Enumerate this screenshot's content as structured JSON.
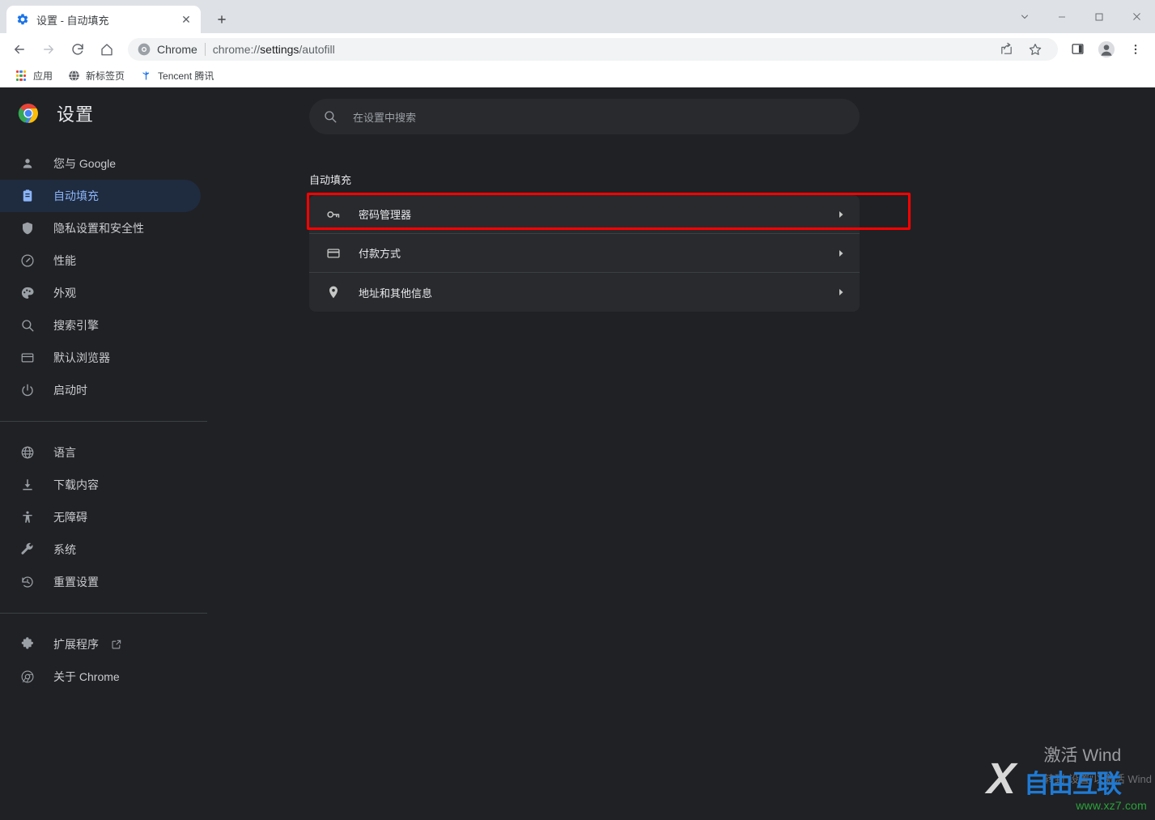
{
  "window": {
    "controls": [
      {
        "name": "tab-search-button",
        "glyph": "chevron-down"
      },
      {
        "name": "minimize-button",
        "glyph": "minimize"
      },
      {
        "name": "maximize-button",
        "glyph": "maximize"
      },
      {
        "name": "close-button",
        "glyph": "close"
      }
    ]
  },
  "tab": {
    "title": "设置 - 自动填充",
    "close_label": "✕",
    "newtab_label": "+"
  },
  "toolbar": {
    "back_label": "←",
    "forward_label": "→",
    "reload_label": "⟳",
    "home_label": "⌂",
    "omnibox": {
      "scheme_label": "Chrome",
      "url_prefix": "chrome://",
      "url_bold": "settings",
      "url_suffix": "/autofill"
    },
    "share_name": "share-icon",
    "bookmark_name": "star-icon",
    "sidepanel_name": "side-panel-icon",
    "profile_name": "profile-avatar-icon",
    "menu_name": "three-dot-menu-icon"
  },
  "bookmarks": [
    {
      "label": "应用",
      "icon": "apps-grid-icon"
    },
    {
      "label": "新标签页",
      "icon": "globe-icon"
    },
    {
      "label": "Tencent 腾讯",
      "icon": "tencent-icon"
    }
  ],
  "sidebar": {
    "brand": "设置",
    "groups": [
      {
        "items": [
          {
            "label": "您与 Google",
            "icon": "person-icon",
            "active": false
          },
          {
            "label": "自动填充",
            "icon": "clipboard-icon",
            "active": true
          },
          {
            "label": "隐私设置和安全性",
            "icon": "shield-icon",
            "active": false
          },
          {
            "label": "性能",
            "icon": "speedometer-icon",
            "active": false
          },
          {
            "label": "外观",
            "icon": "palette-icon",
            "active": false
          },
          {
            "label": "搜索引擎",
            "icon": "search-icon",
            "active": false
          },
          {
            "label": "默认浏览器",
            "icon": "browser-window-icon",
            "active": false
          },
          {
            "label": "启动时",
            "icon": "power-icon",
            "active": false
          }
        ]
      },
      {
        "items": [
          {
            "label": "语言",
            "icon": "globe-icon",
            "active": false
          },
          {
            "label": "下载内容",
            "icon": "download-icon",
            "active": false
          },
          {
            "label": "无障碍",
            "icon": "accessibility-icon",
            "active": false
          },
          {
            "label": "系统",
            "icon": "wrench-icon",
            "active": false
          },
          {
            "label": "重置设置",
            "icon": "history-restore-icon",
            "active": false
          }
        ]
      },
      {
        "items": [
          {
            "label": "扩展程序",
            "icon": "puzzle-icon",
            "active": false,
            "external": true
          },
          {
            "label": "关于 Chrome",
            "icon": "chrome-icon",
            "active": false
          }
        ]
      }
    ]
  },
  "search": {
    "placeholder": "在设置中搜索",
    "icon": "search-icon"
  },
  "main": {
    "section_title": "自动填充",
    "rows": [
      {
        "label": "密码管理器",
        "icon": "key-icon",
        "highlighted": true
      },
      {
        "label": "付款方式",
        "icon": "credit-card-icon",
        "highlighted": false
      },
      {
        "label": "地址和其他信息",
        "icon": "location-pin-icon",
        "highlighted": false
      }
    ],
    "chevron": "▸"
  },
  "annotation": {
    "highlight_color": "#ff0000"
  },
  "watermarks": {
    "windows_activate_line1": "激活 Wind",
    "windows_activate_line2": "转到\"设置\"以激活 Wind",
    "site_name": "自由互联",
    "site_url": "www.xz7.com",
    "site_mark": "X"
  }
}
